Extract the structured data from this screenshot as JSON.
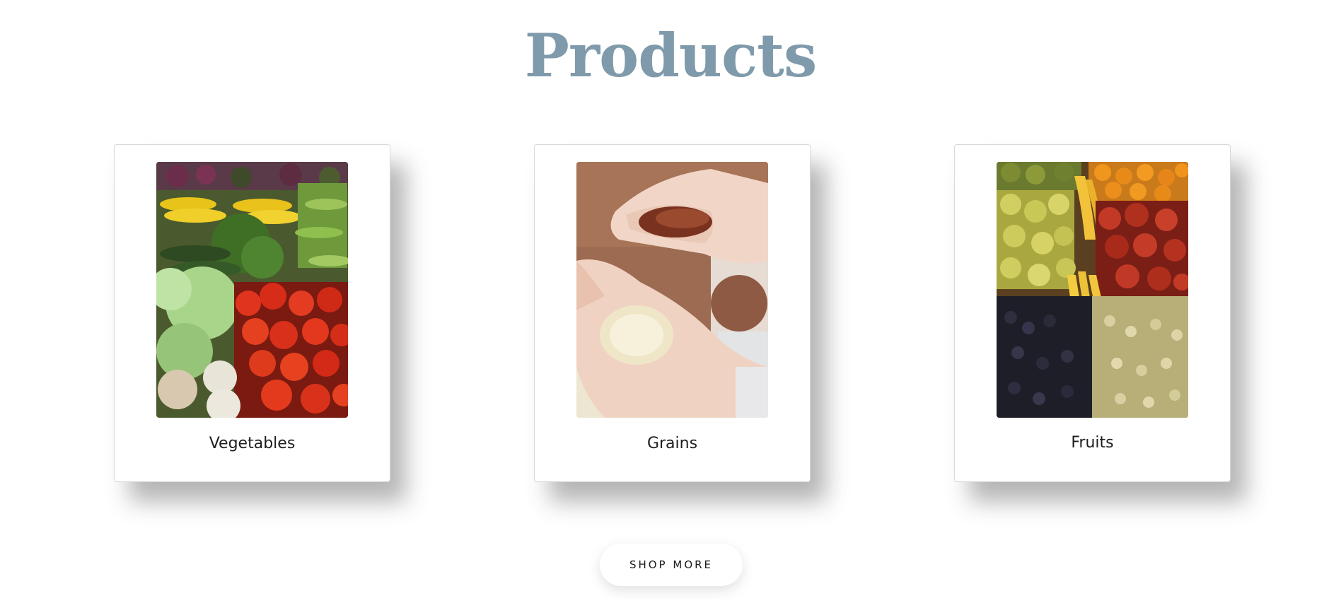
{
  "page": {
    "title": "Products",
    "title_color": "#7f9aab"
  },
  "cards": [
    {
      "label": "Vegetables",
      "image": "vegetables-market-photo"
    },
    {
      "label": "Grains",
      "image": "hands-holding-rice-photo"
    },
    {
      "label": "Fruits",
      "image": "fruit-stand-photo"
    }
  ],
  "actions": {
    "shop_more_label": "SHOP MORE"
  }
}
